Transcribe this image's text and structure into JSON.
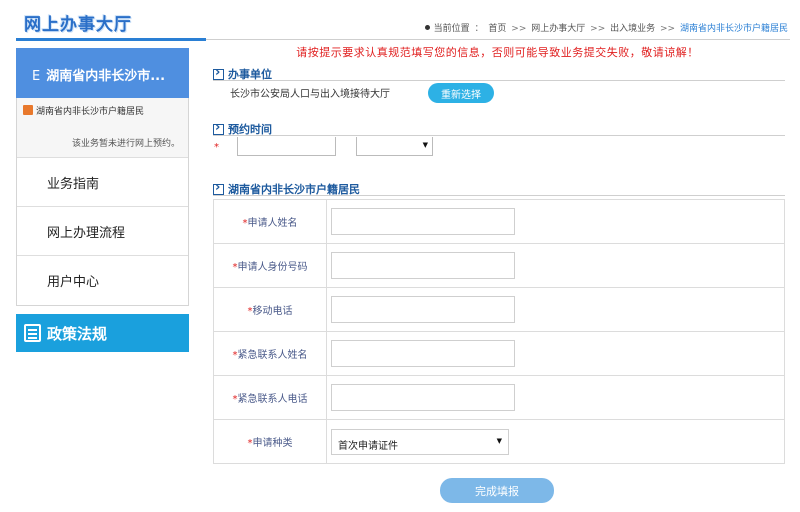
{
  "header": {
    "site_title": "网上办事大厅",
    "breadcrumb": {
      "prefix": "当前位置",
      "separator": ">>",
      "items": [
        "首页",
        "网上办事大厅",
        "出入境业务"
      ],
      "current": "湖南省内非长沙市户籍居民"
    }
  },
  "sidebar": {
    "head": {
      "letter": "E",
      "label": "湖南省内非长沙市..."
    },
    "sub_item": {
      "icon": "document-icon",
      "label": "湖南省内非长沙市户籍居民",
      "note": "该业务暂未进行网上预约。"
    },
    "items": [
      {
        "label": "业务指南"
      },
      {
        "label": "网上办理流程"
      },
      {
        "label": "用户中心"
      }
    ],
    "policy": {
      "icon": "document-list-icon",
      "label": "政策法规"
    }
  },
  "main": {
    "warning": "请按提示要求认真规范填写您的信息，否则可能导致业务提交失败，敬请谅解！",
    "office": {
      "heading": "办事单位",
      "name": "长沙市公安局人口与出入境接待大厅",
      "reselect_label": "重新选择"
    },
    "appointment": {
      "heading": "预约时间",
      "required_mark": "*",
      "date_value": "",
      "time_value": ""
    },
    "form": {
      "heading": "湖南省内非长沙市户籍居民",
      "fields": [
        {
          "label": "申请人姓名",
          "value": ""
        },
        {
          "label": "申请人身份号码",
          "value": ""
        },
        {
          "label": "移动电话",
          "value": ""
        },
        {
          "label": "紧急联系人姓名",
          "value": ""
        },
        {
          "label": "紧急联系人电话",
          "value": ""
        }
      ],
      "type_field": {
        "label": "申请种类",
        "selected": "首次申请证件"
      }
    },
    "submit_label": "完成填报"
  },
  "colors": {
    "primary_blue": "#4f8fe0",
    "policy_blue": "#1aa0dd",
    "warning_red": "#e02020",
    "section_blue": "#1d5a9e"
  }
}
